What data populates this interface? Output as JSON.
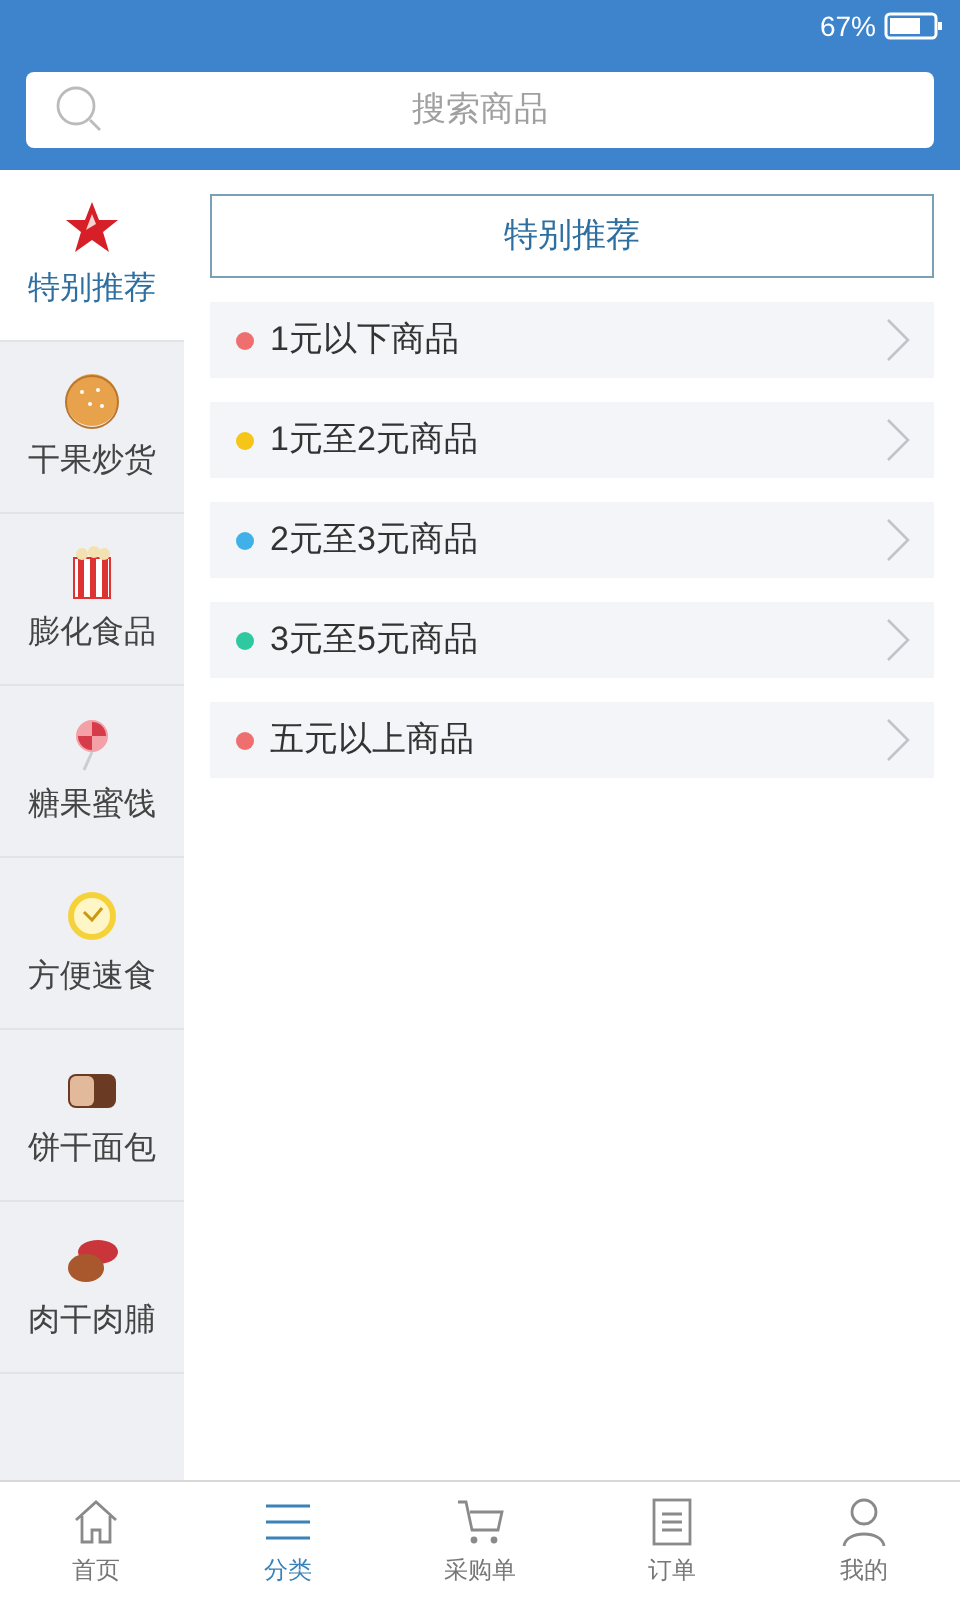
{
  "status_bar": {
    "battery": "67%"
  },
  "search": {
    "placeholder": "搜索商品"
  },
  "sidebar": {
    "items": [
      {
        "label": "特别推荐",
        "selected": true
      },
      {
        "label": "干果炒货",
        "selected": false
      },
      {
        "label": "膨化食品",
        "selected": false
      },
      {
        "label": "糖果蜜饯",
        "selected": false
      },
      {
        "label": "方便速食",
        "selected": false
      },
      {
        "label": "饼干面包",
        "selected": false
      },
      {
        "label": "肉干肉脯",
        "selected": false
      }
    ]
  },
  "section_title": "特别推荐",
  "price_ranges": [
    {
      "label": "1元以下商品",
      "color": "#ef6f6f"
    },
    {
      "label": "1元至2元商品",
      "color": "#f5c518"
    },
    {
      "label": "2元至3元商品",
      "color": "#3fb0e8"
    },
    {
      "label": "3元至5元商品",
      "color": "#2ec9a0"
    },
    {
      "label": "五元以上商品",
      "color": "#ef6f6f"
    }
  ],
  "tab_bar": [
    {
      "label": "首页",
      "selected": false
    },
    {
      "label": "分类",
      "selected": true
    },
    {
      "label": "采购单",
      "selected": false
    },
    {
      "label": "订单",
      "selected": false
    },
    {
      "label": "我的",
      "selected": false
    }
  ]
}
